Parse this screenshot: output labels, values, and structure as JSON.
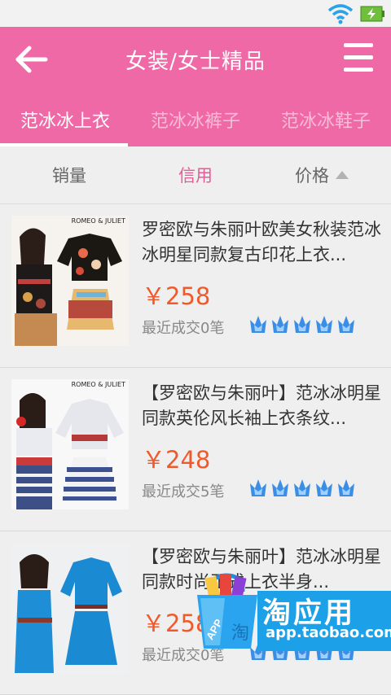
{
  "header": {
    "title": "女装/女士精品"
  },
  "tabs": [
    {
      "label": "范冰冰上衣",
      "active": true
    },
    {
      "label": "范冰冰裤子",
      "active": false
    },
    {
      "label": "范冰冰鞋子",
      "active": false
    }
  ],
  "sort": {
    "sales": "销量",
    "credit": "信用",
    "price": "价格",
    "active": "credit"
  },
  "products": [
    {
      "title": "罗密欧与朱丽叶欧美女秋装范冰冰明星同款复古印花上衣...",
      "price": "￥258",
      "sold": "最近成交0笔",
      "rating_icons": 5,
      "brand": "ROMEO & JULIET"
    },
    {
      "title": "【罗密欧与朱丽叶】范冰冰明星同款英伦风长袖上衣条纹...",
      "price": "￥248",
      "sold": "最近成交5笔",
      "rating_icons": 5,
      "brand": "ROMEO & JULIET"
    },
    {
      "title": "【罗密欧与朱丽叶】范冰冰明星同款时尚正式上衣半身...",
      "price": "￥258",
      "sold": "最近成交0笔",
      "rating_icons": 5,
      "brand": ""
    }
  ],
  "badge": {
    "title": "淘应用",
    "url": "app.taobao.com",
    "bag_label": "APP",
    "bag_char": "淘"
  },
  "colors": {
    "primary": "#f069a7",
    "price": "#f05a2a",
    "rating": "#3a8ee6",
    "badge": "#1ca0e8"
  },
  "icons": [
    "back-arrow-icon",
    "menu-icon",
    "wifi-icon",
    "battery-icon",
    "sort-up-icon",
    "crown-icon"
  ]
}
